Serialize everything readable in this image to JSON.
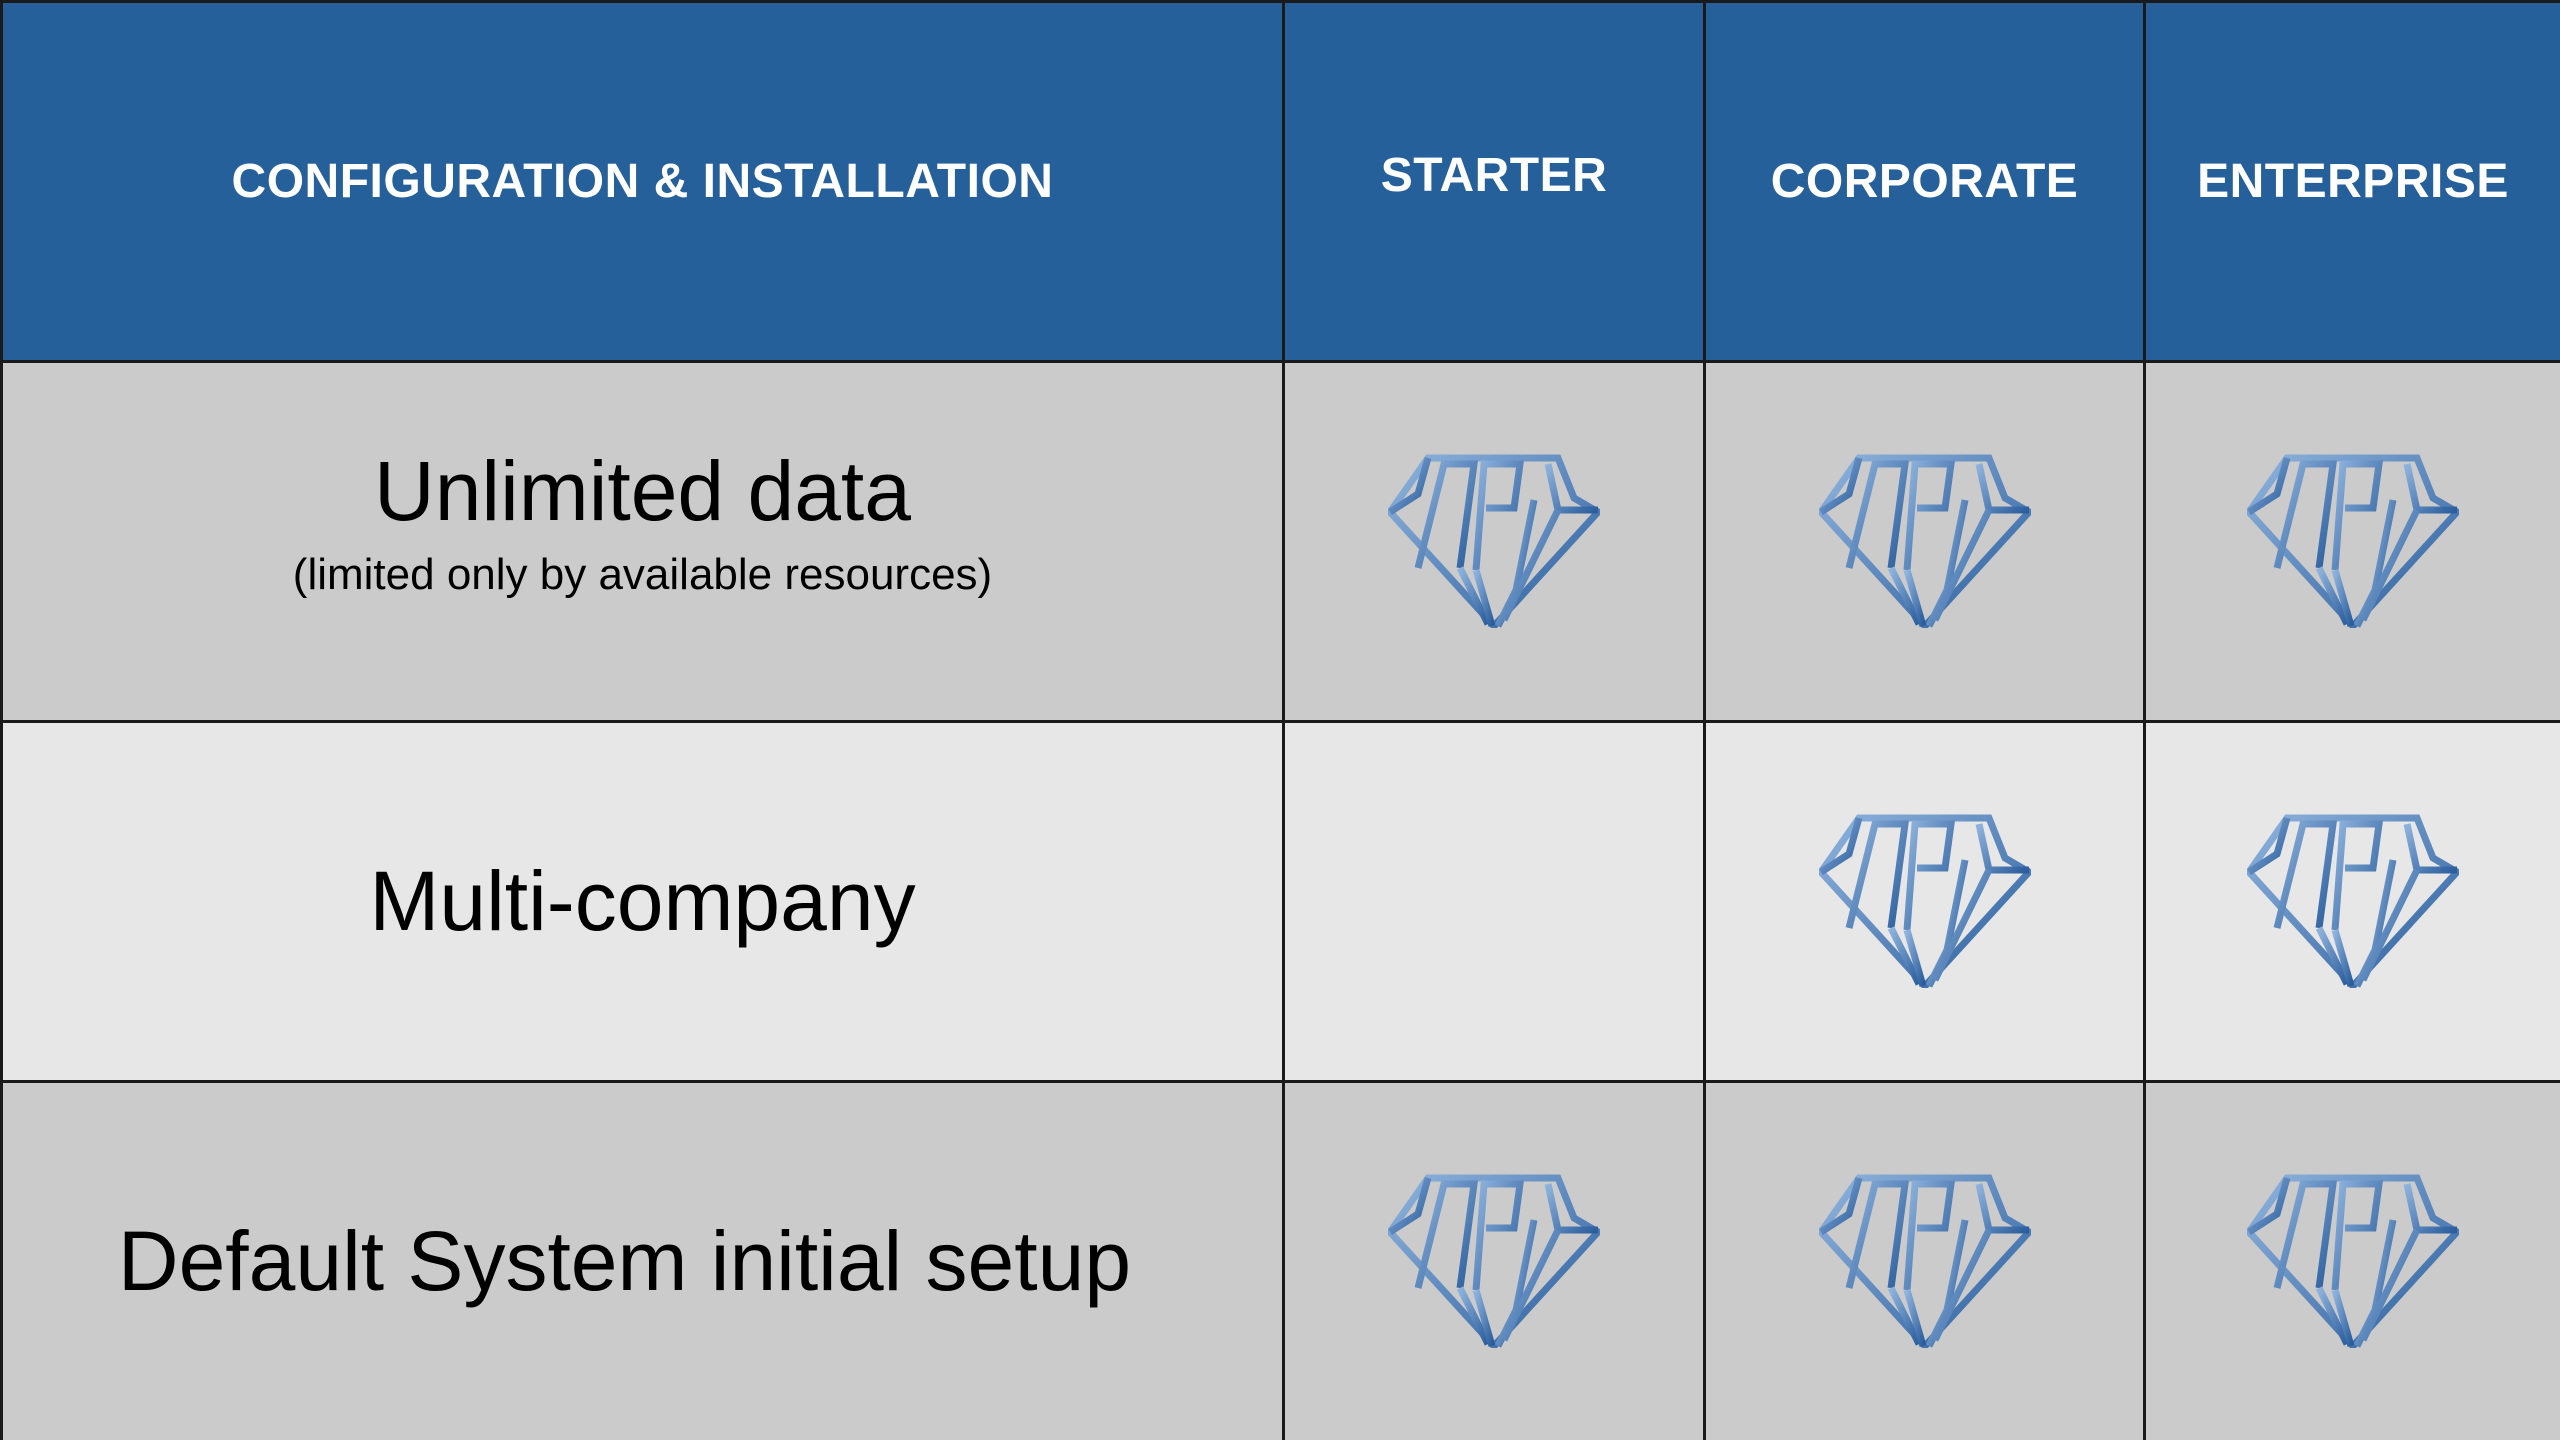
{
  "header": {
    "section_label": "CONFIGURATION & INSTALLATION",
    "plans": [
      "STARTER",
      "CORPORATE",
      "ENTERPRISE"
    ]
  },
  "rows": [
    {
      "title": "Unlimited data",
      "subtitle": "(limited only by available resources)",
      "included": [
        true,
        true,
        true
      ]
    },
    {
      "title": "Multi-company",
      "subtitle": "",
      "included": [
        false,
        true,
        true
      ]
    },
    {
      "title": "Default System initial setup",
      "subtitle": "",
      "included": [
        true,
        true,
        true
      ]
    }
  ],
  "icons": {
    "included_marker": "api-diamond-logo-icon"
  },
  "colors": {
    "header_bg": "#26609b",
    "header_text": "#ffffff",
    "row_dark": "#cbcbcb",
    "row_light": "#e7e7e7",
    "logo_light": "#8fb3dd",
    "logo_dark": "#2a5d9c"
  }
}
